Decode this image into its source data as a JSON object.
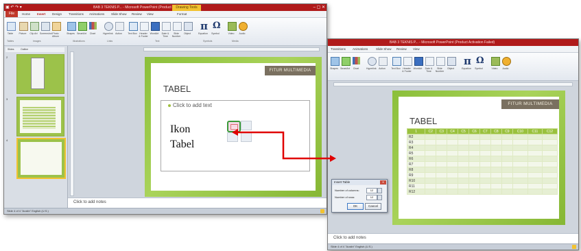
{
  "window1": {
    "title": "BAB 3 TEKNIS P... - Microsoft PowerPoint (Product Activation Failed)",
    "context_tab": "Drawing Tools",
    "tabs": [
      "File",
      "Home",
      "Insert",
      "Design",
      "Transitions",
      "Animations",
      "Slide Show",
      "Review",
      "View",
      "Format"
    ],
    "ribbon_buttons": [
      "Table",
      "Picture",
      "Clip Art",
      "Screenshot",
      "Photo Album",
      "Shapes",
      "SmartArt",
      "Chart",
      "Hyperlink",
      "Action",
      "Text Box",
      "Header & Footer",
      "WordArt",
      "Date & Time",
      "Slide Number",
      "Object",
      "Equation",
      "Symbol",
      "Video",
      "Audio"
    ],
    "ribbon_groups": [
      "Tables",
      "Images",
      "Illustrations",
      "Links",
      "Text",
      "Symbols",
      "Media"
    ],
    "pane_tabs": [
      "Slides",
      "Outline"
    ],
    "slide_numbers": [
      "2",
      "3",
      "4"
    ],
    "banner": "FITUR MULTIMEDIA",
    "slide_title": "TABEL",
    "placeholder": "Click to add text",
    "notes": "Click to add notes",
    "status": "Slide 4 of 4   \"Austin\"   English (U.S.)"
  },
  "annotation": {
    "line1": "Ikon",
    "line2": "Tabel"
  },
  "window2": {
    "title": "BAB 3 TEKNIS P... - Microsoft PowerPoint (Product Activation Failed)",
    "tabs": [
      "Transitions",
      "Animations",
      "Slide Show",
      "Review",
      "View"
    ],
    "ribbon_buttons": [
      "Shapes",
      "SmartArt",
      "Chart",
      "Hyperlink",
      "Action",
      "Text Box",
      "Header & Footer",
      "WordArt",
      "Date & Time",
      "Slide Number",
      "Object",
      "Equation",
      "Symbol",
      "Video",
      "Audio"
    ],
    "banner": "FITUR MULTIMEDIA",
    "slide_title": "TABEL",
    "table_header": [
      "1",
      "C2",
      "C3",
      "C4",
      "C5",
      "C6",
      "C7",
      "C8",
      "C9",
      "C10",
      "C11",
      "C12"
    ],
    "table_rows": [
      "R2",
      "R3",
      "R4",
      "R5",
      "R6",
      "R7",
      "R8",
      "R9",
      "R10",
      "R11",
      "R12"
    ],
    "notes": "Click to add notes",
    "status": "Slide 4 of 4   \"Austin\"   English (U.S.)"
  },
  "dialog": {
    "title": "Insert Table",
    "columns_label": "Number of columns:",
    "columns_value": "12",
    "rows_label": "Number of rows:",
    "rows_value": "12",
    "ok": "OK",
    "cancel": "Cancel"
  },
  "colors": {
    "accent_red": "#b01a1a",
    "slide_green": "#9cc24a",
    "banner": "#7a7060",
    "arrow": "#e00000"
  }
}
